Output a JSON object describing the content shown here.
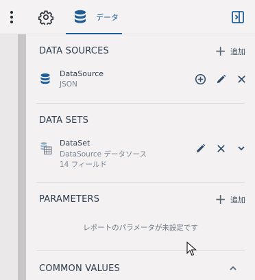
{
  "toolbar": {
    "tab_data_label": "データ"
  },
  "sections": {
    "data_sources": {
      "title": "DATA SOURCES",
      "add_label": "追加",
      "items": [
        {
          "name": "DataSource",
          "subtitle": "JSON"
        }
      ]
    },
    "data_sets": {
      "title": "DATA SETS",
      "items": [
        {
          "name": "DataSet",
          "subtitle": "DataSource データソース",
          "detail": "14 フィールド"
        }
      ]
    },
    "parameters": {
      "title": "PARAMETERS",
      "add_label": "追加",
      "empty_message": "レポートのパラメータが未設定です"
    },
    "common_values": {
      "title": "COMMON VALUES"
    }
  },
  "colors": {
    "accent": "#1f5d96",
    "icon_dark": "#2e4d6b",
    "background": "#f3f1f2"
  },
  "icons": [
    "kebab-icon",
    "gear-icon",
    "database-icon",
    "panel-toggle-icon",
    "plus-icon",
    "plus-circle-icon",
    "pencil-icon",
    "close-icon",
    "chevron-down-icon",
    "chevron-up-icon",
    "dataset-icon",
    "cursor-icon"
  ]
}
